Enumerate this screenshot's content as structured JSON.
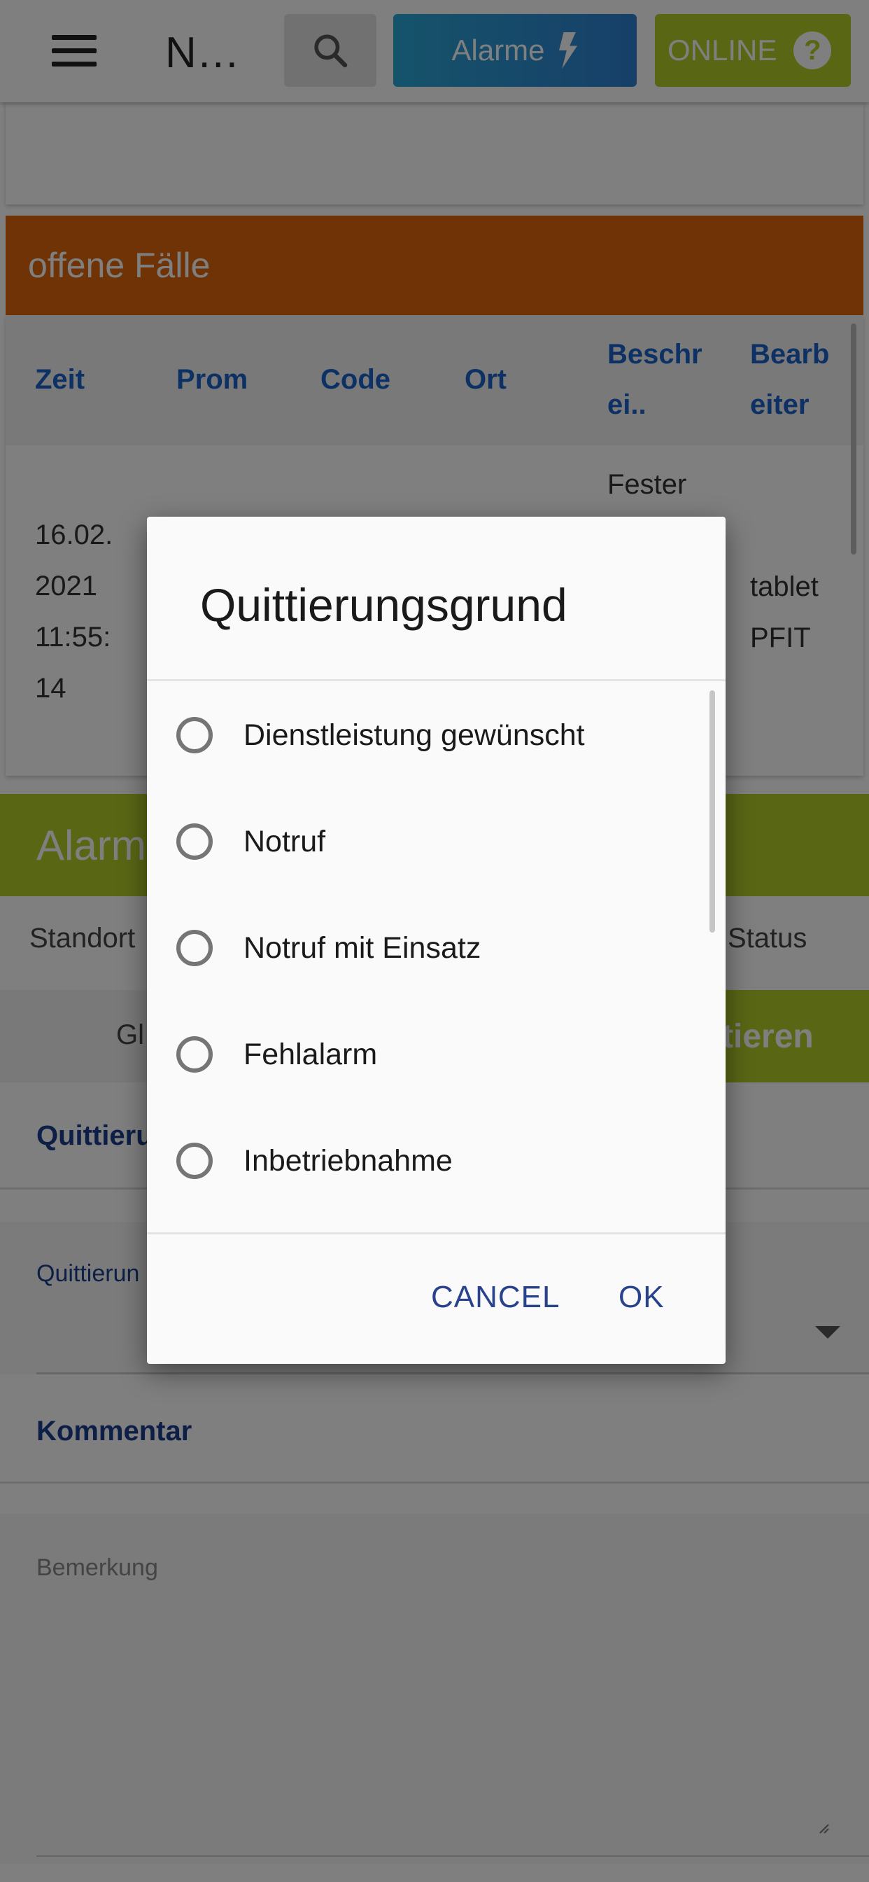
{
  "header": {
    "title": "N…",
    "alarme_label": "Alarme",
    "online_label": "ONLINE",
    "help_symbol": "?"
  },
  "cases": {
    "title": "offene Fälle",
    "columns": [
      {
        "label": "Zeit"
      },
      {
        "label": "Prom"
      },
      {
        "label": "Code"
      },
      {
        "label": "Ort"
      },
      {
        "label": "Beschr ei.."
      },
      {
        "label": "Bearb eiter"
      }
    ],
    "row": {
      "zeit": [
        "16.02.",
        "2021",
        "11:55:",
        "14"
      ],
      "beschreibung": "Fester",
      "bearbeiter": [
        "tablet",
        "PFIT"
      ]
    }
  },
  "alarm": {
    "title": "Alarm",
    "standort_label": "Standort",
    "status_label": "Status",
    "gi_text": "Gl",
    "action_label": "tieren"
  },
  "form": {
    "quittierung_title": "Quittieru",
    "quittierung_label": "Quittierun",
    "kommentar_title": "Kommentar",
    "bemerkung_placeholder": "Bemerkung"
  },
  "dialog": {
    "title": "Quittierungsgrund",
    "options": [
      {
        "label": "Dienstleistung gewünscht",
        "selected": false
      },
      {
        "label": "Notruf",
        "selected": false
      },
      {
        "label": "Notruf mit Einsatz",
        "selected": false
      },
      {
        "label": "Fehlalarm",
        "selected": false
      },
      {
        "label": "Inbetriebnahme",
        "selected": false
      }
    ],
    "cancel_label": "CANCEL",
    "ok_label": "OK"
  },
  "colors": {
    "orange_header": "#e0660a",
    "green_accent": "#b3cf2b",
    "blue_accent": "#2f7fd2",
    "link_blue": "#1b63c8",
    "dialog_button": "#28438c"
  },
  "icons": [
    "menu-icon",
    "search-icon",
    "lightning-icon",
    "help-icon",
    "dropdown-arrow-icon",
    "resize-handle-icon"
  ]
}
